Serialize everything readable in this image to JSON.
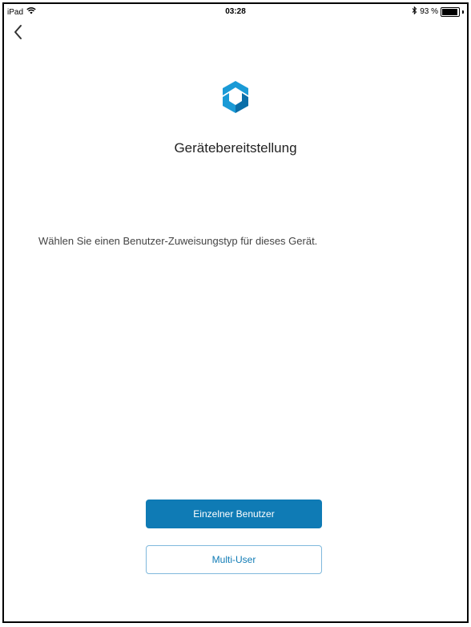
{
  "status_bar": {
    "device": "iPad",
    "time": "03:28",
    "battery_text": "93 %",
    "battery_level": 0.93
  },
  "nav": {
    "back_icon": "chevron-left-icon"
  },
  "logo_icon": "company-portal-logo-icon",
  "colors": {
    "accent": "#0f7bb5",
    "logo_light": "#1a9ad6",
    "logo_dark": "#0a6ea8"
  },
  "page": {
    "title": "Gerätebereitstellung",
    "instruction": "Wählen Sie einen Benutzer-Zuweisungstyp für dieses Gerät."
  },
  "buttons": {
    "single_user": "Einzelner Benutzer",
    "multi_user": "Multi-User"
  }
}
